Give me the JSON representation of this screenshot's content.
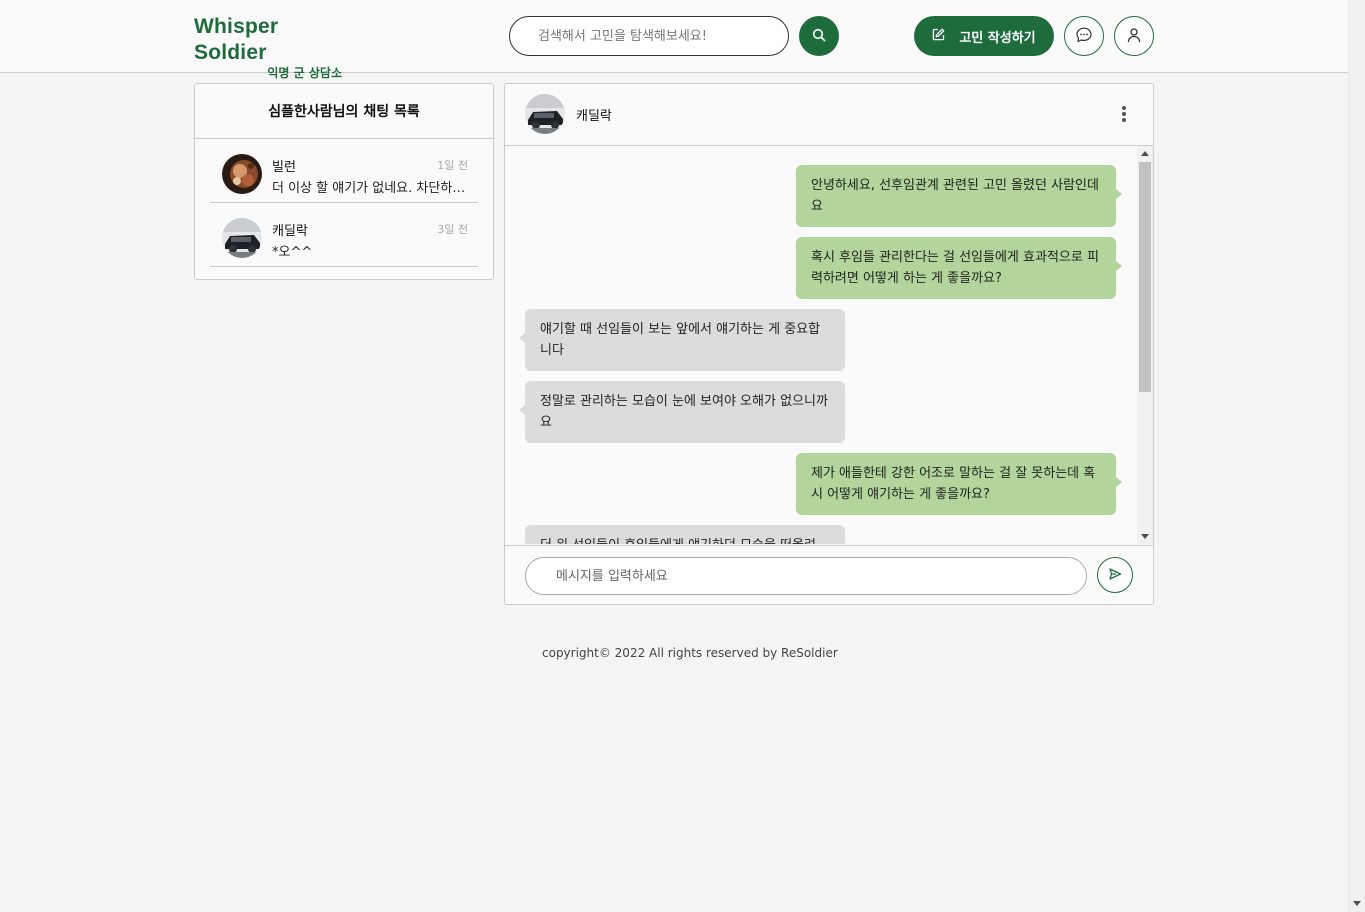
{
  "header": {
    "logo_title": "Whisper Soldier",
    "logo_subtitle": "익명 군 상담소",
    "search_placeholder": "검색해서 고민을 탐색해보세요!",
    "write_button": "고민 작성하기",
    "icons": {
      "search": "search-icon",
      "write": "edit-icon",
      "chat": "chat-bubble-icon",
      "profile": "user-icon"
    }
  },
  "chat_list": {
    "title": "심플한사람님의 채팅 목록",
    "items": [
      {
        "name": "빌런",
        "time": "1일 전",
        "preview": "더 이상 할 얘기가 없네요. 차단하겠습니다"
      },
      {
        "name": "캐딜락",
        "time": "3일 전",
        "preview": "*오^^"
      }
    ]
  },
  "chat": {
    "partner": "캐딜락",
    "messages": [
      {
        "type": "sent",
        "text": "안녕하세요, 선후임관계 관련된 고민 올렸던 사람인데요"
      },
      {
        "type": "sent",
        "text": "혹시 후임들 관리한다는 걸 선임들에게 효과적으로 피력하려면 어떻게 하는 게 좋을까요?"
      },
      {
        "type": "recv",
        "text": "얘기할 때 선임들이 보는 앞에서 얘기하는 게 중요합니다"
      },
      {
        "type": "recv",
        "text": "정말로 관리하는 모습이 눈에 보여야 오해가 없으니까요"
      },
      {
        "type": "sent",
        "text": "제가 애들한테 강한 어조로 말하는 걸 잘 못하는데 혹시 어떻게 얘기하는 게 좋을까요?"
      },
      {
        "type": "recv",
        "text": "더 위 선임들이 후임들에게 얘기하던 모습을 떠올려 보세요"
      }
    ],
    "input_placeholder": "메시지를 입력하세요"
  },
  "footer": {
    "text": "copyright© 2022 All rights reserved by ReSoldier"
  },
  "colors": {
    "brand": "#1e6b3c",
    "sent_bubble": "#b3d49b",
    "recv_bubble": "#dcdcdc"
  }
}
